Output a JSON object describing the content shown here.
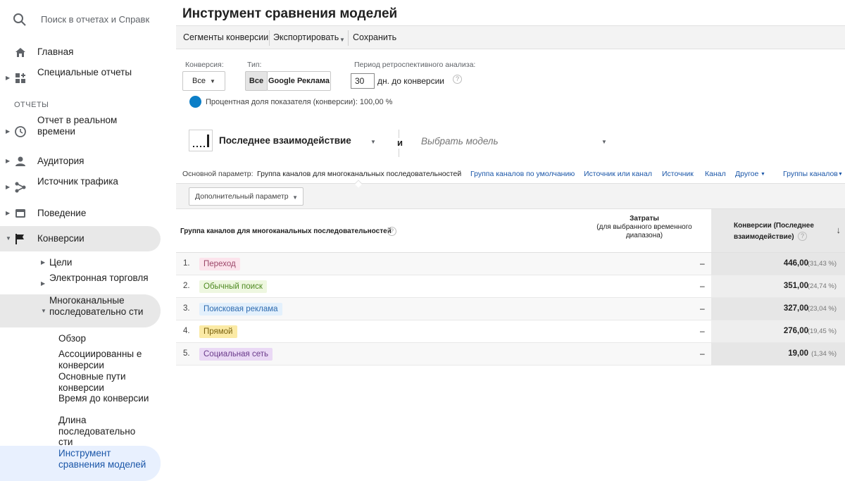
{
  "search": {
    "placeholder": "Поиск в отчетах и Справк"
  },
  "sidebar": {
    "home": "Главная",
    "custom": "Специальные отчеты",
    "section": "ОТЧЕТЫ",
    "realtime": "Отчет в реальном времени",
    "audience": "Аудитория",
    "traffic": "Источник трафика",
    "behavior": "Поведение",
    "conversions": "Конверсии",
    "goals": "Цели",
    "ecommerce": "Электронная торговля",
    "multichannel": "Многоканальные последовательно сти",
    "leaves": {
      "overview": "Обзор",
      "assisted": "Ассоциированны е конверсии",
      "top_paths": "Основные пути конверсии",
      "time_lag": "Время до конверсии",
      "path_length": "Длина последовательно сти",
      "model_tool": "Инструмент сравнения моделей"
    }
  },
  "page": {
    "title": "Инструмент сравнения моделей"
  },
  "toolbar": {
    "segments": "Сегменты конверсии",
    "export": "Экспортировать",
    "save": "Сохранить"
  },
  "controls": {
    "conversion_label": "Конверсия:",
    "conversion_value": "Все",
    "type_label": "Тип:",
    "type_all": "Все",
    "type_ads": "Google Реклама",
    "lookback_label": "Период ретроспективного анализа:",
    "lookback_value": "30",
    "lookback_suffix": "дн. до конверсии",
    "percent_text": "Процентная доля показателя (конверсии): 100,00 %"
  },
  "models": {
    "selected": "Последнее взаимодействие",
    "and": "и",
    "placeholder": "Выбрать модель"
  },
  "dimensions": {
    "label": "Основной параметр:",
    "primary": "Группа каналов для многоканальных последовательностей",
    "links": [
      "Группа каналов по умолчанию",
      "Источник или канал",
      "Источник",
      "Канал",
      "Другое",
      "Группы каналов"
    ],
    "secondary": "Дополнительный параметр"
  },
  "table": {
    "col1": "Группа каналов для многоканальных последовательностей",
    "cost_title": "Затраты",
    "cost_sub": "(для выбранного временного диапазона)",
    "conv_title": "Конверсии (Последнее взаимодействие)",
    "rows": [
      {
        "idx": "1.",
        "channel": "Переход",
        "cost": "–",
        "value": "446,00",
        "pct": "(31,43 %)"
      },
      {
        "idx": "2.",
        "channel": "Обычный поиск",
        "cost": "–",
        "value": "351,00",
        "pct": "(24,74 %)"
      },
      {
        "idx": "3.",
        "channel": "Поисковая реклама",
        "cost": "–",
        "value": "327,00",
        "pct": "(23,04 %)"
      },
      {
        "idx": "4.",
        "channel": "Прямой",
        "cost": "–",
        "value": "276,00",
        "pct": "(19,45 %)"
      },
      {
        "idx": "5.",
        "channel": "Социальная сеть",
        "cost": "–",
        "value": "19,00",
        "pct": "(1,34 %)"
      }
    ]
  },
  "colors": {
    "accent": "#1a56a8",
    "chip_referral_bg": "#fce4ec",
    "chip_referral_fg": "#9c4668",
    "chip_organic_bg": "#eef7e0",
    "chip_organic_fg": "#4f8a22",
    "chip_paid_bg": "#e3f0fc",
    "chip_paid_fg": "#2f6cb0",
    "chip_direct_bg": "#fbeaa5",
    "chip_direct_fg": "#7a6210",
    "chip_social_bg": "#ead9f5",
    "chip_social_fg": "#6a3a8a"
  }
}
